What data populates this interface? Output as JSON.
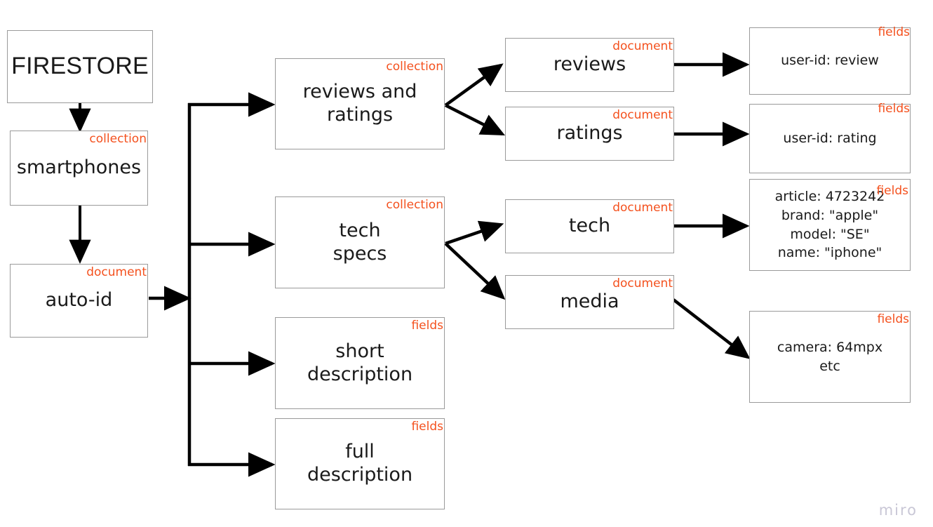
{
  "diagram": {
    "title": "Firestore data model diagram",
    "accent_color": "#f4511e",
    "box_border_color": "#9a9a9a",
    "arrow_color": "#000000",
    "background": "#ffffff",
    "watermark": "miro"
  },
  "nodes": {
    "firestore": {
      "label": "FIRESTORE",
      "tag": ""
    },
    "smartphones": {
      "label": "smartphones",
      "tag": "collection"
    },
    "auto_id": {
      "label": "auto-id",
      "tag": "document"
    },
    "reviews_and_ratings": {
      "label": "reviews and\nratings",
      "tag": "collection"
    },
    "tech_specs": {
      "label": "tech\nspecs",
      "tag": "collection"
    },
    "short_description": {
      "label": "short\ndescription",
      "tag": "fields"
    },
    "full_description": {
      "label": "full\ndescription",
      "tag": "fields"
    },
    "reviews": {
      "label": "reviews",
      "tag": "document"
    },
    "ratings": {
      "label": "ratings",
      "tag": "document"
    },
    "tech": {
      "label": "tech",
      "tag": "document"
    },
    "media": {
      "label": "media",
      "tag": "document"
    },
    "review_fields": {
      "label": "user-id: review",
      "tag": "fields"
    },
    "rating_fields": {
      "label": "user-id: rating",
      "tag": "fields"
    },
    "tech_fields": {
      "label": "article: 4723242\nbrand: \"apple\"\nmodel: \"SE\"\nname: \"iphone\"",
      "tag": "fields"
    },
    "media_fields": {
      "label": "camera: 64mpx\netc",
      "tag": "fields"
    }
  },
  "edges": [
    {
      "from": "firestore",
      "to": "smartphones",
      "style": "straight-down"
    },
    {
      "from": "smartphones",
      "to": "auto_id",
      "style": "straight-down"
    },
    {
      "from": "auto_id",
      "to": "trunk",
      "style": "straight-right"
    },
    {
      "from": "trunk",
      "to": "reviews_and_ratings",
      "style": "elbow-right"
    },
    {
      "from": "trunk",
      "to": "tech_specs",
      "style": "elbow-right"
    },
    {
      "from": "trunk",
      "to": "short_description",
      "style": "elbow-right"
    },
    {
      "from": "trunk",
      "to": "full_description",
      "style": "elbow-right"
    },
    {
      "from": "reviews_and_ratings",
      "to": "reviews",
      "style": "diagonal-up"
    },
    {
      "from": "reviews_and_ratings",
      "to": "ratings",
      "style": "diagonal-down"
    },
    {
      "from": "tech_specs",
      "to": "tech",
      "style": "diagonal-up"
    },
    {
      "from": "tech_specs",
      "to": "media",
      "style": "diagonal-down"
    },
    {
      "from": "reviews",
      "to": "review_fields",
      "style": "straight-right"
    },
    {
      "from": "ratings",
      "to": "rating_fields",
      "style": "straight-right"
    },
    {
      "from": "tech",
      "to": "tech_fields",
      "style": "straight-right"
    },
    {
      "from": "media",
      "to": "media_fields",
      "style": "diagonal-down"
    }
  ]
}
